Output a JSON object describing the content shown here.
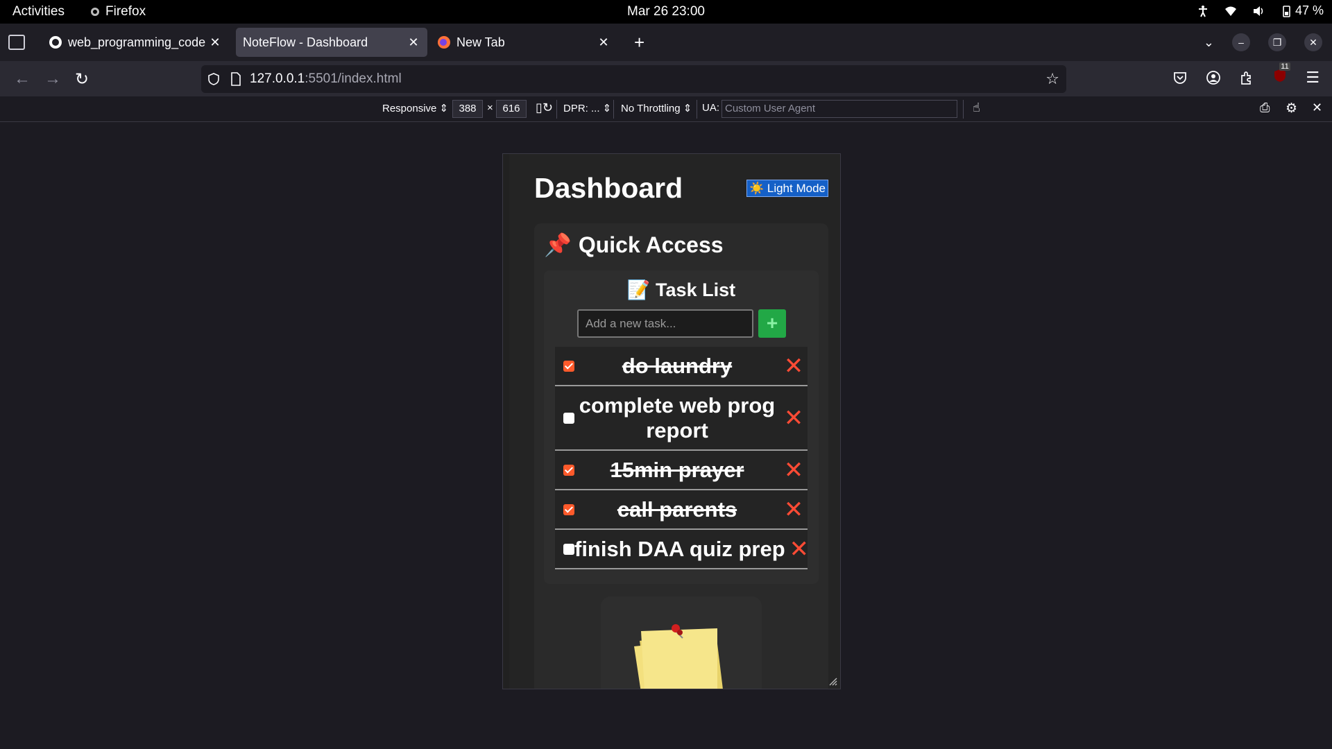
{
  "topbar": {
    "activities": "Activities",
    "app_name": "Firefox",
    "clock": "Mar 26  23:00",
    "battery": "47 %"
  },
  "tabs": [
    {
      "label": "web_programming_code",
      "icon": "github-icon",
      "active": false
    },
    {
      "label": "NoteFlow - Dashboard",
      "icon": "",
      "active": true
    },
    {
      "label": "New Tab",
      "icon": "firefox-icon",
      "active": false
    }
  ],
  "urlbar": {
    "host": "127.0.0.1",
    "path": ":5501/index.html"
  },
  "rdm": {
    "device": "Responsive",
    "width": "388",
    "times": "×",
    "height": "616",
    "dpr": "DPR: ...",
    "throttling": "No Throttling",
    "ua_label": "UA:",
    "ua_placeholder": "Custom User Agent"
  },
  "extensions": {
    "badge_count": "11"
  },
  "page": {
    "title": "Dashboard",
    "mode_button": "☀️ Light Mode",
    "quick_access": {
      "icon": "📌",
      "title": "Quick Access"
    },
    "task_list": {
      "icon": "📝",
      "title": "Task List",
      "input_placeholder": "Add a new task...",
      "add_button": "+",
      "delete_glyph": "✕",
      "items": [
        {
          "text": "do laundry",
          "done": true
        },
        {
          "text": "complete web prog report",
          "done": false
        },
        {
          "text": "15min prayer",
          "done": true
        },
        {
          "text": "call parents",
          "done": true
        },
        {
          "text": "finish DAA quiz prep",
          "done": false
        }
      ]
    }
  },
  "colors": {
    "accent_blue": "#1560c7",
    "add_green": "#22a846",
    "delete_red": "#ff4b35",
    "checkbox_orange": "#ff5a2b"
  }
}
